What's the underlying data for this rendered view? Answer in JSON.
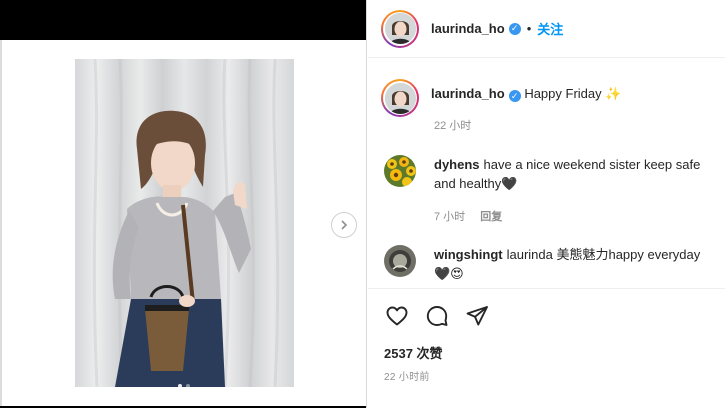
{
  "post": {
    "author": "laurinda_ho",
    "follow_label": "关注",
    "separator": "•",
    "caption": "Happy Friday ✨",
    "caption_time": "22 小时",
    "likes": "2537 次赞",
    "posted_time": "22 小时前"
  },
  "comments": [
    {
      "username": "dyhens",
      "text": "have a nice weekend sister keep safe and healthy🖤",
      "time": "7 小时",
      "reply_label": "回复"
    },
    {
      "username": "wingshingt",
      "text": "laurinda 美態魅力happy everyday 🖤😍",
      "time": "",
      "reply_label": ""
    }
  ],
  "icons": {
    "like": "heart-icon",
    "comment": "comment-icon",
    "share": "share-icon",
    "verified": "verified-badge-icon",
    "next": "chevron-right-icon"
  },
  "colors": {
    "accent": "#0095f6",
    "verified": "#3897f0",
    "muted": "#8e8e8e",
    "text": "#262626"
  },
  "carousel": {
    "slide_count": 2,
    "active_slide": 1
  }
}
